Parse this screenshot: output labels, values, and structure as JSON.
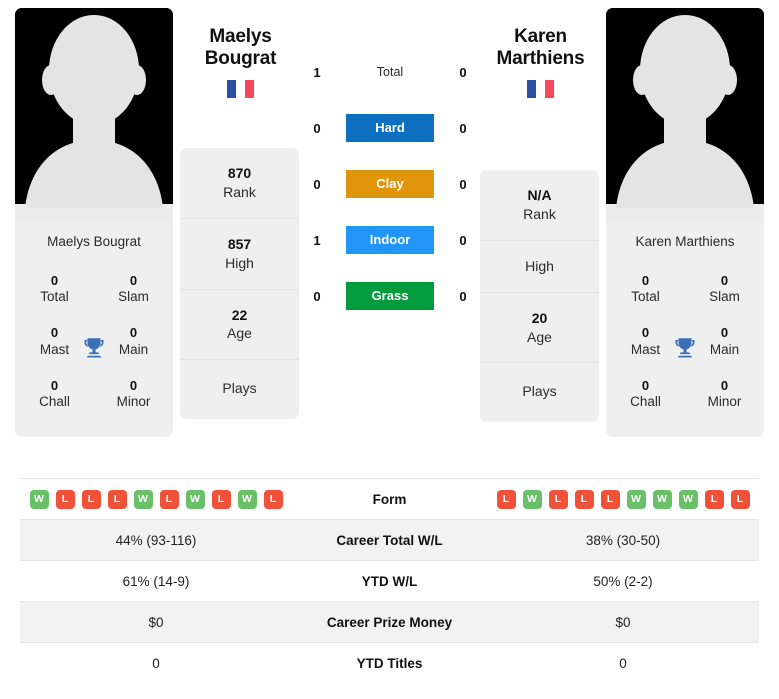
{
  "players": {
    "left": {
      "name_display": "Maelys\nBougrat",
      "first_name": "Maelys",
      "last_name": "Bougrat",
      "full_name": "Maelys Bougrat",
      "country_flag": "france-flag",
      "rank": "870",
      "rank_label": "Rank",
      "high": "857",
      "high_label": "High",
      "age": "22",
      "age_label": "Age",
      "plays_label": "Plays",
      "plays_value": "",
      "titles": [
        {
          "value": "0",
          "label": "Total"
        },
        {
          "value": "0",
          "label": "Slam"
        },
        {
          "value": "0",
          "label": "Mast"
        },
        {
          "value": "0",
          "label": "Main"
        },
        {
          "value": "0",
          "label": "Chall"
        },
        {
          "value": "0",
          "label": "Minor"
        }
      ]
    },
    "right": {
      "name_display": "Karen\nMarthiens",
      "first_name": "Karen",
      "last_name": "Marthiens",
      "full_name": "Karen Marthiens",
      "country_flag": "france-flag",
      "rank": "N/A",
      "rank_label": "Rank",
      "high": "",
      "high_label": "High",
      "age": "20",
      "age_label": "Age",
      "plays_label": "Plays",
      "plays_value": "",
      "titles": [
        {
          "value": "0",
          "label": "Total"
        },
        {
          "value": "0",
          "label": "Slam"
        },
        {
          "value": "0",
          "label": "Mast"
        },
        {
          "value": "0",
          "label": "Main"
        },
        {
          "value": "0",
          "label": "Chall"
        },
        {
          "value": "0",
          "label": "Minor"
        }
      ]
    }
  },
  "head_to_head": [
    {
      "surface": "Total",
      "left": "1",
      "right": "0",
      "color": "transparent",
      "styled": false
    },
    {
      "surface": "Hard",
      "left": "0",
      "right": "0",
      "color": "#0c6fc0",
      "styled": true
    },
    {
      "surface": "Clay",
      "left": "0",
      "right": "0",
      "color": "#e0960c",
      "styled": true
    },
    {
      "surface": "Indoor",
      "left": "1",
      "right": "0",
      "color": "#2196f7",
      "styled": true
    },
    {
      "surface": "Grass",
      "left": "0",
      "right": "0",
      "color": "#049a3e",
      "styled": true
    }
  ],
  "stats_table": {
    "rows": [
      {
        "label": "Form",
        "type": "form",
        "left_form": [
          "W",
          "L",
          "L",
          "L",
          "W",
          "L",
          "W",
          "L",
          "W",
          "L"
        ],
        "right_form": [
          "L",
          "W",
          "L",
          "L",
          "L",
          "W",
          "W",
          "W",
          "L",
          "L"
        ],
        "shaded": false
      },
      {
        "label": "Career Total W/L",
        "type": "text",
        "left": "44% (93-116)",
        "right": "38% (30-50)",
        "shaded": true
      },
      {
        "label": "YTD W/L",
        "type": "text",
        "left": "61% (14-9)",
        "right": "50% (2-2)",
        "shaded": false
      },
      {
        "label": "Career Prize Money",
        "type": "text",
        "left": "$0",
        "right": "$0",
        "shaded": true
      },
      {
        "label": "YTD Titles",
        "type": "text",
        "left": "0",
        "right": "0",
        "shaded": false
      }
    ]
  },
  "colors": {
    "hard": "#0c6fc0",
    "clay": "#e0960c",
    "indoor": "#2196f7",
    "grass": "#049a3e",
    "win": "#6abf69",
    "loss": "#ef5139",
    "trophy": "#3a6fb5",
    "panel_bg": "#efefef",
    "row_shade": "#f2f2f2"
  }
}
